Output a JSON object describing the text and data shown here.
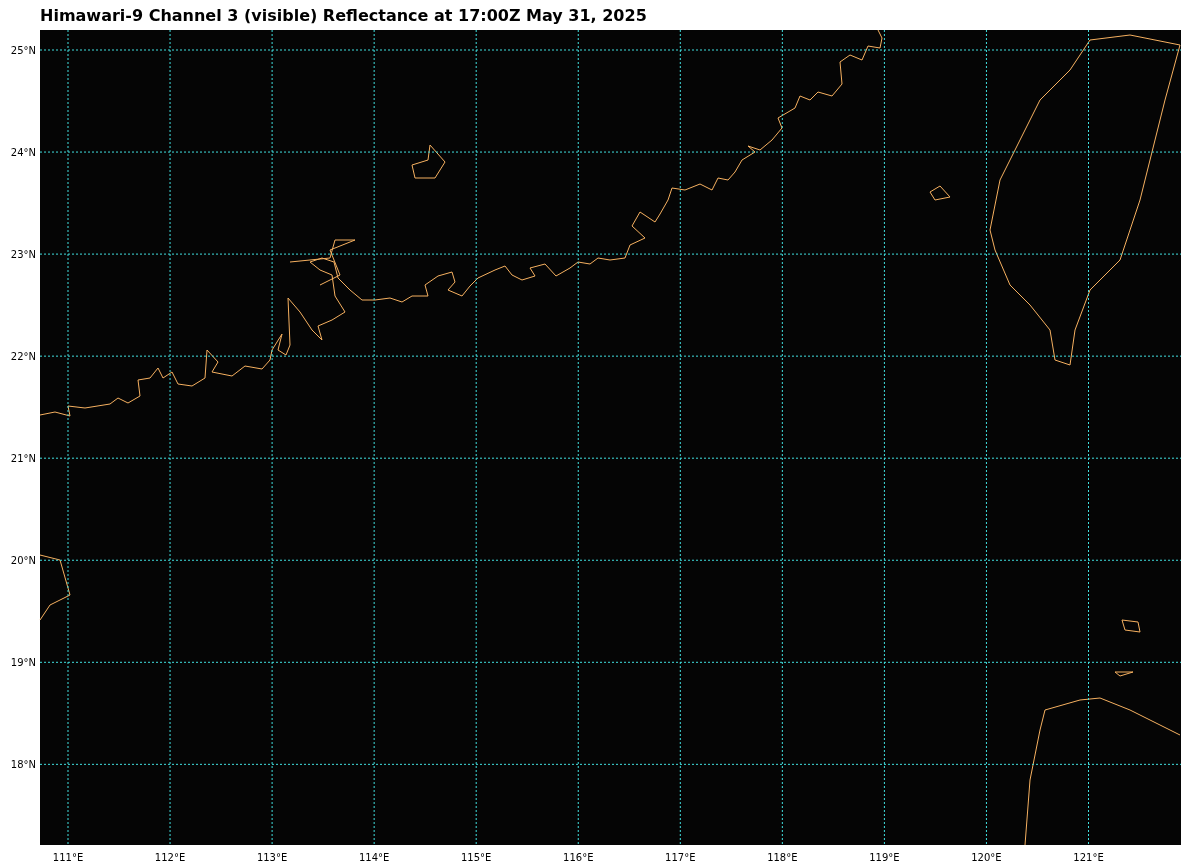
{
  "title": "Himawari-9 Channel 3 (visible) Reflectance at 17:00Z May 31, 2025",
  "map": {
    "lat_labels": [
      "25°N",
      "24°N",
      "23°N",
      "22°N",
      "21°N",
      "20°N",
      "19°N",
      "18°N"
    ],
    "lon_labels": [
      "111°E",
      "112°E",
      "113°E",
      "114°E",
      "115°E",
      "116°E",
      "117°E",
      "118°E",
      "119°E",
      "120°E",
      "121°E"
    ]
  }
}
